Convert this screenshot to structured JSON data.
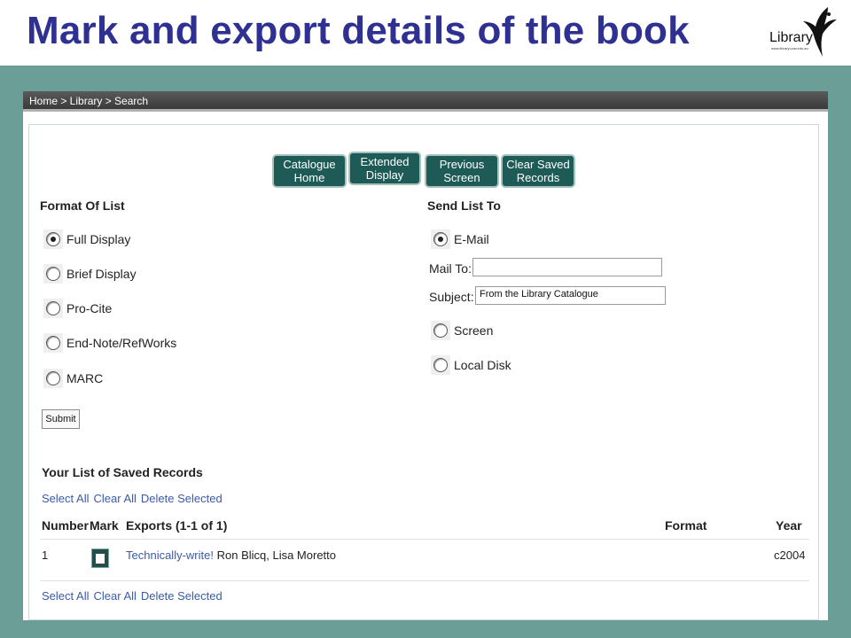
{
  "slide": {
    "title": "Mark and export details of the book"
  },
  "logo": {
    "text": "Library",
    "url": "www.library.uow.edu.au"
  },
  "breadcrumb": "Home > Library > Search",
  "nav_buttons": [
    {
      "line1": "Catalogue",
      "line2": "Home"
    },
    {
      "line1": "Extended",
      "line2": "Display"
    },
    {
      "line1": "Previous",
      "line2": "Screen"
    },
    {
      "line1": "Clear Saved",
      "line2": "Records"
    }
  ],
  "format_of_list": {
    "heading": "Format Of List",
    "options": [
      "Full Display",
      "Brief Display",
      "Pro-Cite",
      "End-Note/RefWorks",
      "MARC"
    ],
    "selected": 0
  },
  "send_list_to": {
    "heading": "Send List To",
    "email_label": "E-Mail",
    "mail_to_label": "Mail To:",
    "mail_to_value": "",
    "subject_label": "Subject:",
    "subject_value": "From the Library Catalogue",
    "screen_label": "Screen",
    "local_disk_label": "Local Disk",
    "selected": "E-Mail"
  },
  "submit_label": "Submit",
  "saved_records": {
    "heading": "Your List of Saved Records",
    "links": [
      "Select All",
      "Clear All",
      "Delete Selected"
    ],
    "columns": {
      "number": "Number",
      "mark": "Mark",
      "exports": "Exports (1-1 of 1)",
      "format": "Format",
      "year": "Year"
    },
    "rows": [
      {
        "number": "1",
        "title": "Technically-write!",
        "authors": "Ron Blicq, Lisa Moretto",
        "format": "",
        "year": "c2004"
      }
    ]
  }
}
